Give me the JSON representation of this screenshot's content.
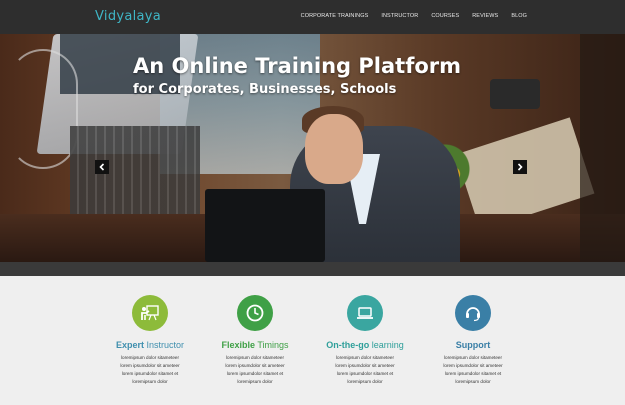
{
  "header": {
    "logo": "Vidyalaya",
    "nav": [
      "CORPORATE TRAININGS",
      "INSTRUCTOR",
      "COURSES",
      "REVIEWS",
      "BLOG"
    ]
  },
  "hero": {
    "title": "An Online Training Platform",
    "subtitle": "for Corporates, Businesses, Schools",
    "prev_icon": "chevron-left-icon",
    "next_icon": "chevron-right-icon"
  },
  "features": [
    {
      "title_bold": "Expert",
      "title_light": " Instructor",
      "icon": "presenter-icon",
      "color": "#8dbb3a",
      "title_color": "#3f8fae",
      "lines": [
        "loremipsum dolor sitameteer",
        "lorem ipsumdolor sit ameteer",
        "lorem ipsumdolor sitamet et",
        "loremipsum dolor"
      ]
    },
    {
      "title_bold": "Flexible",
      "title_light": " Timings",
      "icon": "clock-icon",
      "color": "#3fa046",
      "title_color": "#3fa046",
      "lines": [
        "loremipsum dolor sitameteer",
        "lorem ipsumdolor sit ameteer",
        "lorem ipsumdolor sitamet et",
        "loremipsum dolor"
      ]
    },
    {
      "title_bold": "On-the-go",
      "title_light": " learning",
      "icon": "laptop-icon",
      "color": "#3aa6a0",
      "title_color": "#2f9f9a",
      "lines": [
        "loremipsum dolor sitameteer",
        "lorem ipsumdolor sit ameteer",
        "lorem ipsumdolor sitamet et",
        "loremipsum dolor"
      ]
    },
    {
      "title_bold": "Support",
      "title_light": "",
      "icon": "headset-icon",
      "color": "#3a7fa6",
      "title_color": "#3a7fa6",
      "lines": [
        "loremipsum dolor sitameteer",
        "lorem ipsumdolor sit ameteer",
        "lorem ipsumdolor sitamet et",
        "loremipsum dolor"
      ]
    }
  ]
}
